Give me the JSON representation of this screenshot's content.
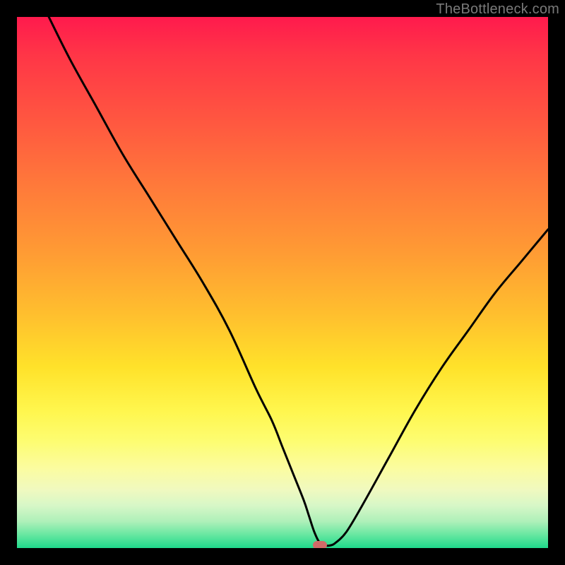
{
  "watermark": "TheBottleneck.com",
  "colors": {
    "background": "#000000",
    "curve": "#000000",
    "marker": "#d06a68"
  },
  "chart_data": {
    "type": "line",
    "title": "",
    "xlabel": "",
    "ylabel": "",
    "xlim": [
      0,
      100
    ],
    "ylim": [
      0,
      100
    ],
    "grid": false,
    "legend": false,
    "series": [
      {
        "name": "curve",
        "x": [
          6,
          10,
          15,
          20,
          25,
          30,
          35,
          40,
          45,
          48,
          50,
          52,
          54,
          55,
          56,
          57,
          58,
          59,
          60,
          62,
          65,
          70,
          75,
          80,
          85,
          90,
          95,
          100
        ],
        "y": [
          100,
          92,
          83,
          74,
          66,
          58,
          50,
          41,
          30,
          24,
          19,
          14,
          9,
          6,
          3,
          1,
          0.5,
          0.5,
          1,
          3,
          8,
          17,
          26,
          34,
          41,
          48,
          54,
          60
        ]
      }
    ],
    "marker": {
      "x": 57,
      "y": 0.5
    },
    "background_gradient": [
      {
        "stop": 0.0,
        "color": "#ff1a4d"
      },
      {
        "stop": 0.3,
        "color": "#ff7a3a"
      },
      {
        "stop": 0.6,
        "color": "#ffe22a"
      },
      {
        "stop": 0.85,
        "color": "#f0f9bf"
      },
      {
        "stop": 1.0,
        "color": "#1fd98b"
      }
    ]
  }
}
